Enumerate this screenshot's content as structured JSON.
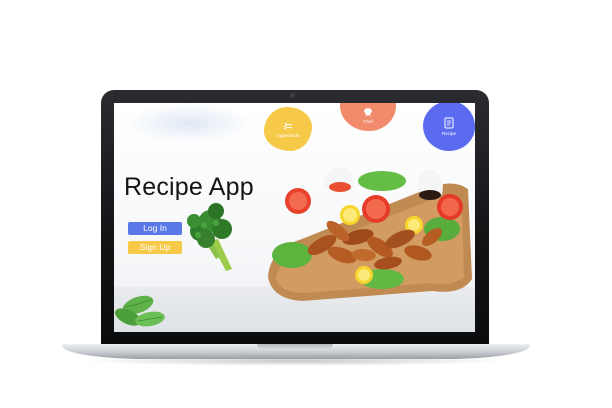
{
  "app": {
    "title": "Recipe App"
  },
  "categories": [
    {
      "label": "Ingredients",
      "color": "#f7c948",
      "icon": "ingredients-icon"
    },
    {
      "label": "Chef",
      "color": "#f28b6b",
      "icon": "chef-hat-icon"
    },
    {
      "label": "Recipe",
      "color": "#5a6bf0",
      "icon": "recipe-book-icon"
    }
  ],
  "auth": {
    "login_label": "Log In",
    "signup_label": "Sign Up",
    "login_color": "#5b78e8",
    "signup_color": "#f7c948"
  },
  "images": {
    "hero": "chicken-wings-platter",
    "broccoli": "broccoli",
    "mint": "mint-leaves"
  }
}
